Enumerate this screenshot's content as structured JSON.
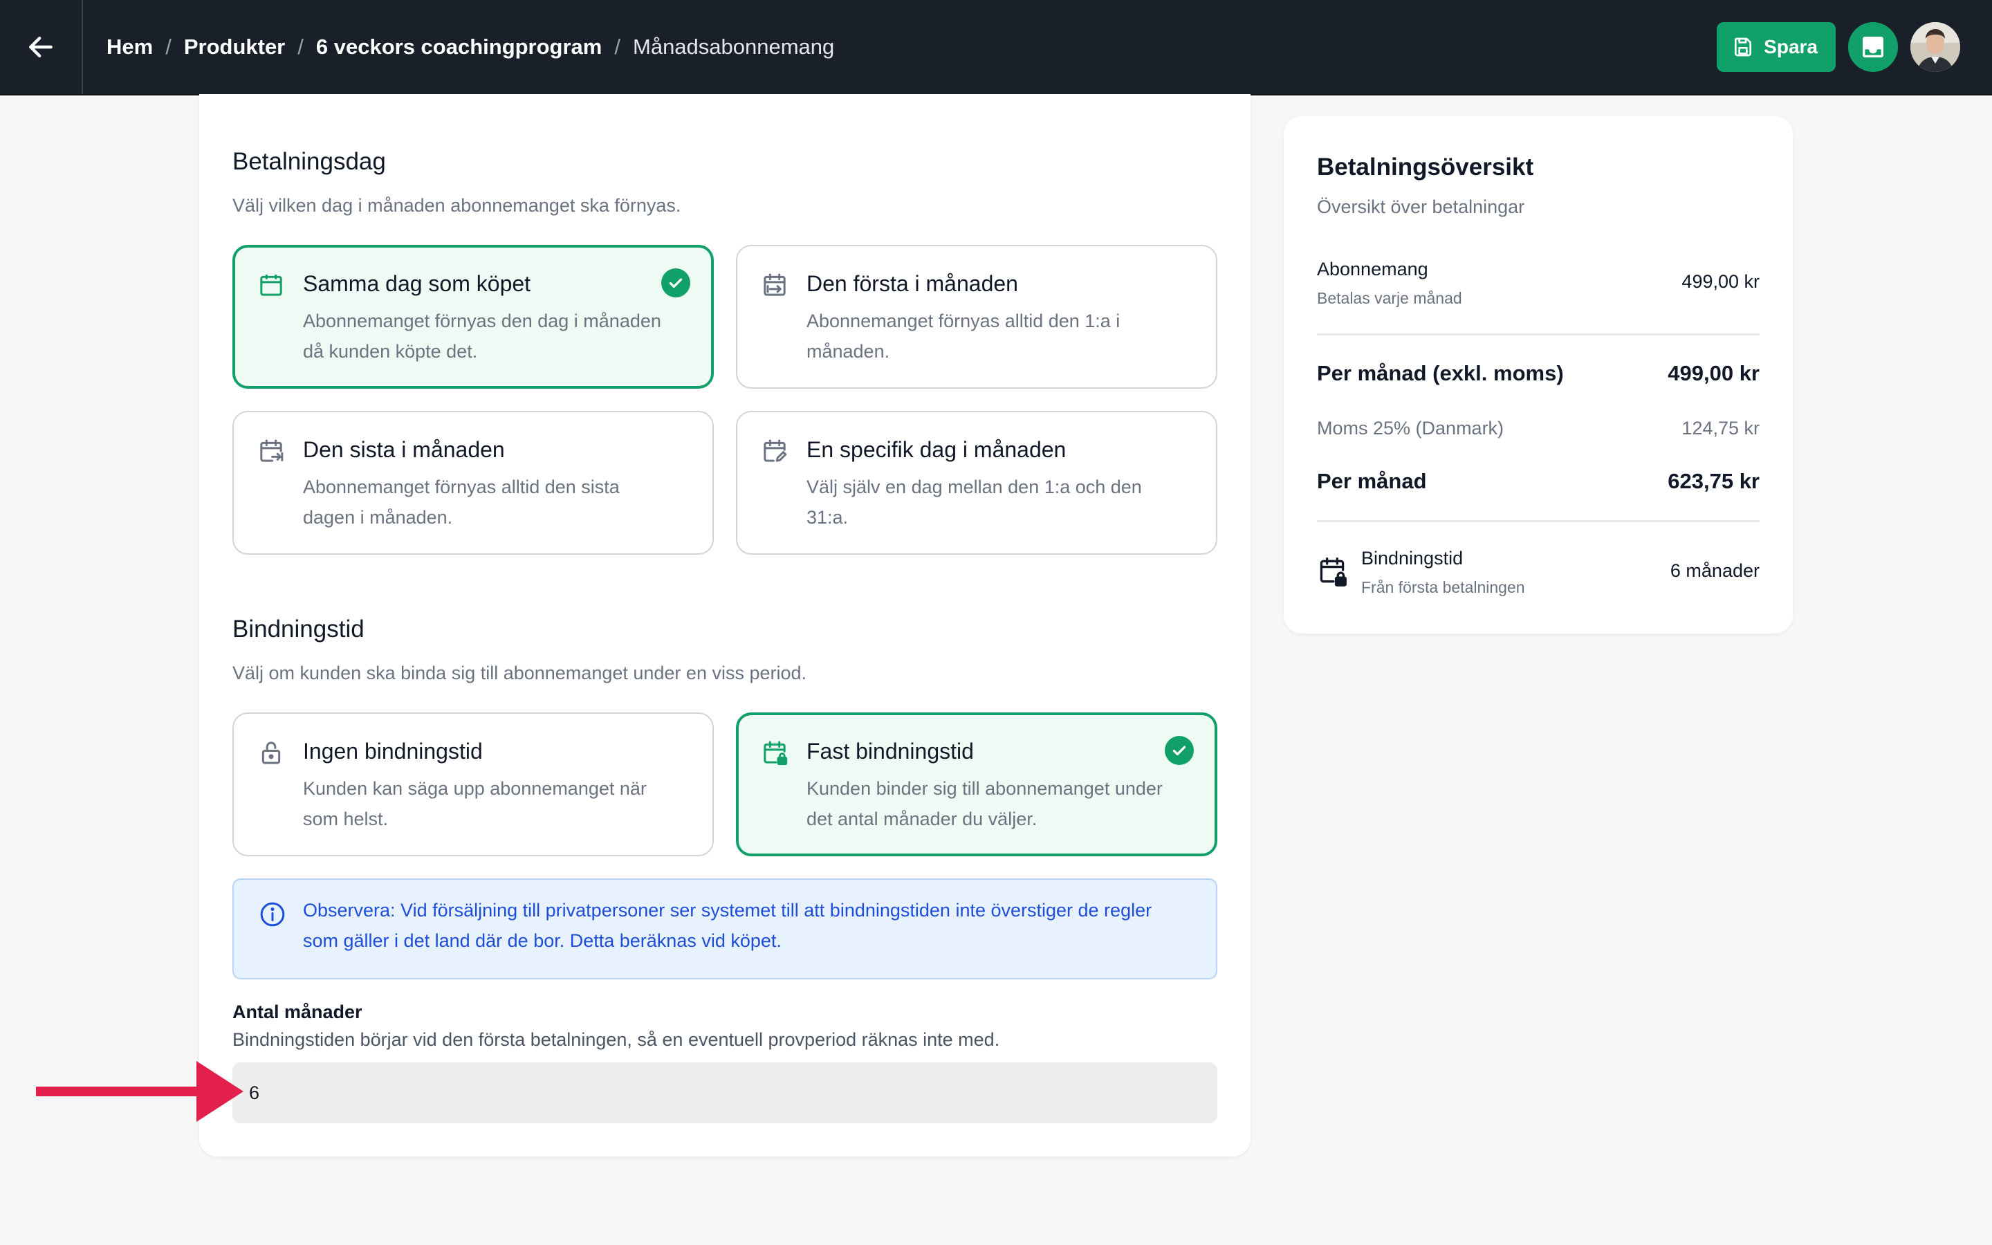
{
  "breadcrumb": {
    "items": [
      "Hem",
      "Produkter",
      "6 veckors coachingprogram"
    ],
    "current": "Månadsabonnemang",
    "separator": "/"
  },
  "toolbar": {
    "save_label": "Spara"
  },
  "payment_day": {
    "title": "Betalningsdag",
    "description": "Välj vilken dag i månaden abonnemanget ska förnyas.",
    "options": [
      {
        "title": "Samma dag som köpet",
        "description": "Abonnemanget förnyas den dag i månaden då kunden köpte det.",
        "icon": "calendar-icon",
        "selected": true
      },
      {
        "title": "Den första i månaden",
        "description": "Abonnemanget förnyas alltid den 1:a i månaden.",
        "icon": "calendar-first-icon",
        "selected": false
      },
      {
        "title": "Den sista i månaden",
        "description": "Abonnemanget förnyas alltid den sista dagen i månaden.",
        "icon": "calendar-last-icon",
        "selected": false
      },
      {
        "title": "En specifik dag i månaden",
        "description": "Välj själv en dag mellan den 1:a och den 31:a.",
        "icon": "calendar-edit-icon",
        "selected": false
      }
    ]
  },
  "binding": {
    "title": "Bindningstid",
    "description": "Välj om kunden ska binda sig till abonnemanget under en viss period.",
    "options": [
      {
        "title": "Ingen bindningstid",
        "description": "Kunden kan säga upp abonnemanget när som helst.",
        "icon": "unlock-icon",
        "selected": false
      },
      {
        "title": "Fast bindningstid",
        "description": "Kunden binder sig till abonnemanget under det antal månader du väljer.",
        "icon": "calendar-lock-icon",
        "selected": true
      }
    ],
    "notice": "Observera: Vid försäljning till privatpersoner ser systemet till att bindningstiden inte överstiger de regler som gäller i det land där de bor. Detta beräknas vid köpet.",
    "months_label": "Antal månader",
    "months_help": "Bindningstiden börjar vid den första betalningen, så en eventuell provperiod räknas inte med.",
    "months_value": "6"
  },
  "summary": {
    "title": "Betalningsöversikt",
    "subtitle": "Översikt över betalningar",
    "subscription_label": "Abonnemang",
    "subscription_sub": "Betalas varje månad",
    "subscription_value": "499,00 kr",
    "per_month_excl_label": "Per månad (exkl. moms)",
    "per_month_excl_value": "499,00 kr",
    "vat_label": "Moms 25% (Danmark)",
    "vat_value": "124,75 kr",
    "per_month_label": "Per månad",
    "per_month_value": "623,75 kr",
    "binding_label": "Bindningstid",
    "binding_sub": "Från första betalningen",
    "binding_value": "6 månader"
  },
  "colors": {
    "topbar": "#1a202a",
    "accent": "#12a06a",
    "selected_bg": "#eefaf4",
    "notice_bg": "#e8f1fe",
    "notice_text": "#1d4ed8",
    "arrow": "#e3204b"
  }
}
